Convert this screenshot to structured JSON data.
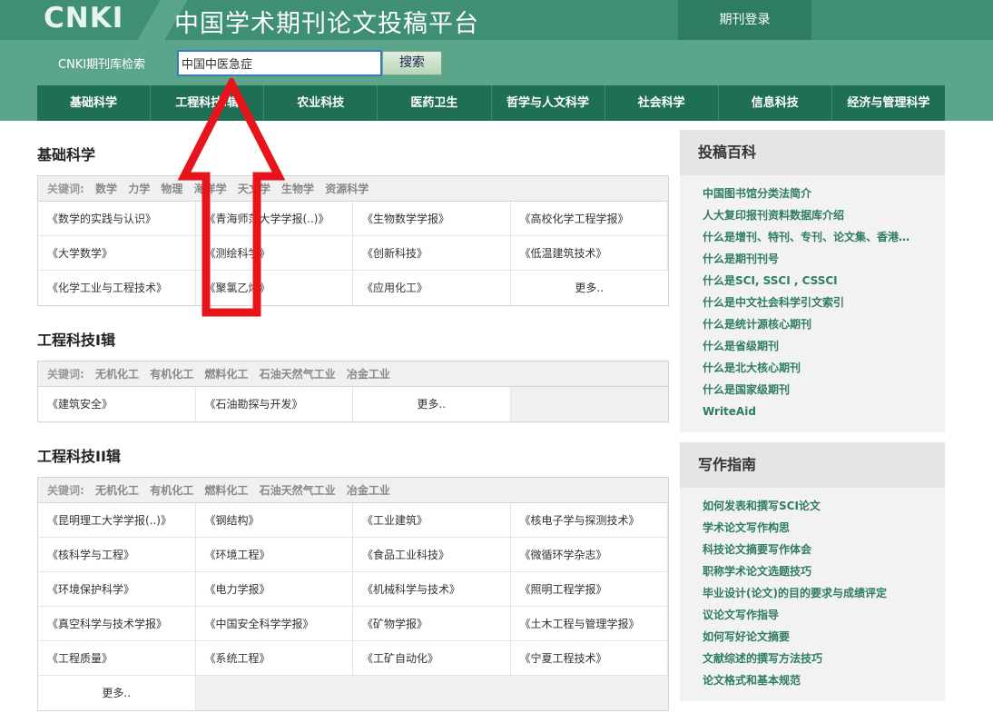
{
  "header": {
    "logo": "CNKI",
    "title": "中国学术期刊论文投稿平台",
    "login": "期刊登录"
  },
  "search": {
    "label": "CNKI期刊库检索",
    "value": "中国中医急症",
    "button": "搜索"
  },
  "nav": [
    "基础科学",
    "工程科技Ⅰ辑",
    "农业科技",
    "医药卫生",
    "哲学与人文科学",
    "社会科学",
    "信息科技",
    "经济与管理科学"
  ],
  "sections": [
    {
      "title": "基础科学",
      "kw_label": "关键词:",
      "keywords": [
        "数学",
        "力学",
        "物理",
        "海洋学",
        "天文学",
        "生物学",
        "资源科学"
      ],
      "journals": [
        "《数学的实践与认识》",
        "《青海师范大学学报(..)》",
        "《生物数学学报》",
        "《高校化学工程学报》",
        "《大学数学》",
        "《测绘科学》",
        "《创新科技》",
        "《低温建筑技术》",
        "《化学工业与工程技术》",
        "《聚氯乙烯》",
        "《应用化工》"
      ],
      "more": "更多.."
    },
    {
      "title": "工程科技I辑",
      "kw_label": "关键词:",
      "keywords": [
        "无机化工",
        "有机化工",
        "燃料化工",
        "石油天然气工业",
        "冶金工业"
      ],
      "journals": [
        "《建筑安全》",
        "《石油勘探与开发》"
      ],
      "more": "更多.."
    },
    {
      "title": "工程科技II辑",
      "kw_label": "关键词:",
      "keywords": [
        "无机化工",
        "有机化工",
        "燃料化工",
        "石油天然气工业",
        "冶金工业"
      ],
      "journals": [
        "《昆明理工大学学报(..)》",
        "《钢结构》",
        "《工业建筑》",
        "《核电子学与探测技术》",
        "《核科学与工程》",
        "《环境工程》",
        "《食品工业科技》",
        "《微循环学杂志》",
        "《环境保护科学》",
        "《电力学报》",
        "《机械科学与技术》",
        "《照明工程学报》",
        "《真空科学与技术学报》",
        "《中国安全科学学报》",
        "《矿物学报》",
        "《土木工程与管理学报》",
        "《工程质量》",
        "《系统工程》",
        "《工矿自动化》",
        "《宁夏工程技术》"
      ],
      "more": "更多.."
    }
  ],
  "sidebar": [
    {
      "title": "投稿百科",
      "links": [
        "中国图书馆分类法简介",
        "人大复印报刊资料数据库介绍",
        "什么是增刊、特刊、专刊、论文集、香港…",
        "什么是期刊刊号",
        "什么是SCI, SSCI , CSSCI",
        "什么是中文社会科学引文索引",
        "什么是统计源核心期刊",
        "什么是省级期刊",
        "什么是北大核心期刊",
        "什么是国家级期刊",
        "WriteAid"
      ]
    },
    {
      "title": "写作指南",
      "links": [
        "如何发表和撰写SCI论文",
        "学术论文写作构思",
        "科技论文摘要写作体会",
        "职称学术论文选题技巧",
        "毕业设计(论文)的目的要求与成绩评定",
        "议论文写作指导",
        "如何写好论文摘要",
        "文献综述的撰写方法技巧",
        "论文格式和基本规范"
      ]
    }
  ],
  "colors": {
    "header": "#3e8f74",
    "nav": "#1f6e56",
    "arrow": "#e8141c"
  }
}
